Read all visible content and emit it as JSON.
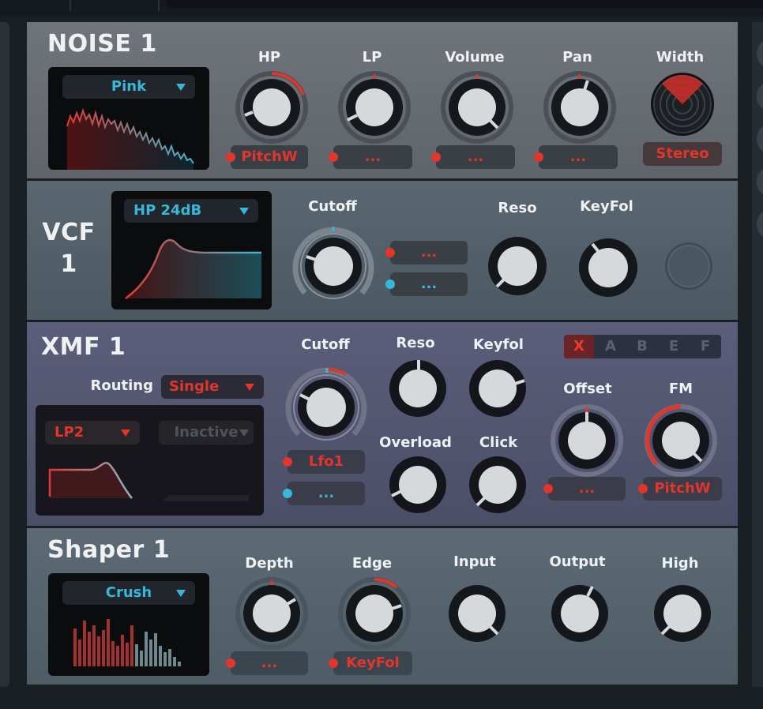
{
  "colors": {
    "accent_red": "#e2352b",
    "accent_blue": "#38b8d8",
    "knob": "#d6d9dc"
  },
  "noise": {
    "title": "NOISE 1",
    "dropdown": "Pink",
    "knobs": [
      {
        "label": "HP",
        "mod": "PitchW",
        "mod_active": true
      },
      {
        "label": "LP",
        "mod": "...",
        "mod_active": false
      },
      {
        "label": "Volume",
        "mod": "...",
        "mod_active": false
      },
      {
        "label": "Pan",
        "mod": "...",
        "mod_active": false
      },
      {
        "label": "Width",
        "mod": "Stereo",
        "mod_active": true
      }
    ]
  },
  "vcf": {
    "title_line1": "VCF",
    "title_line2": "1",
    "dropdown": "HP 24dB",
    "cutoff_label": "Cutoff",
    "mod1": "...",
    "mod2": "...",
    "reso_label": "Reso",
    "keyfol_label": "KeyFol"
  },
  "xmf": {
    "title": "XMF 1",
    "routing_label": "Routing",
    "routing_value": "Single",
    "filter1": "LP2",
    "filter2": "Inactive",
    "cutoff_label": "Cutoff",
    "cutoff_mod1": "Lfo1",
    "cutoff_mod2": "...",
    "reso_label": "Reso",
    "keyfol_label": "Keyfol",
    "overload_label": "Overload",
    "click_label": "Click",
    "tabs": [
      "X",
      "A",
      "B",
      "E",
      "F"
    ],
    "offset_label": "Offset",
    "offset_mod": "...",
    "fm_label": "FM",
    "fm_mod": "PitchW"
  },
  "shaper": {
    "title": "Shaper 1",
    "dropdown": "Crush",
    "knobs": [
      {
        "label": "Depth",
        "mod": "..."
      },
      {
        "label": "Edge",
        "mod": "KeyFol"
      },
      {
        "label": "Input"
      },
      {
        "label": "Output"
      },
      {
        "label": "High"
      }
    ]
  }
}
